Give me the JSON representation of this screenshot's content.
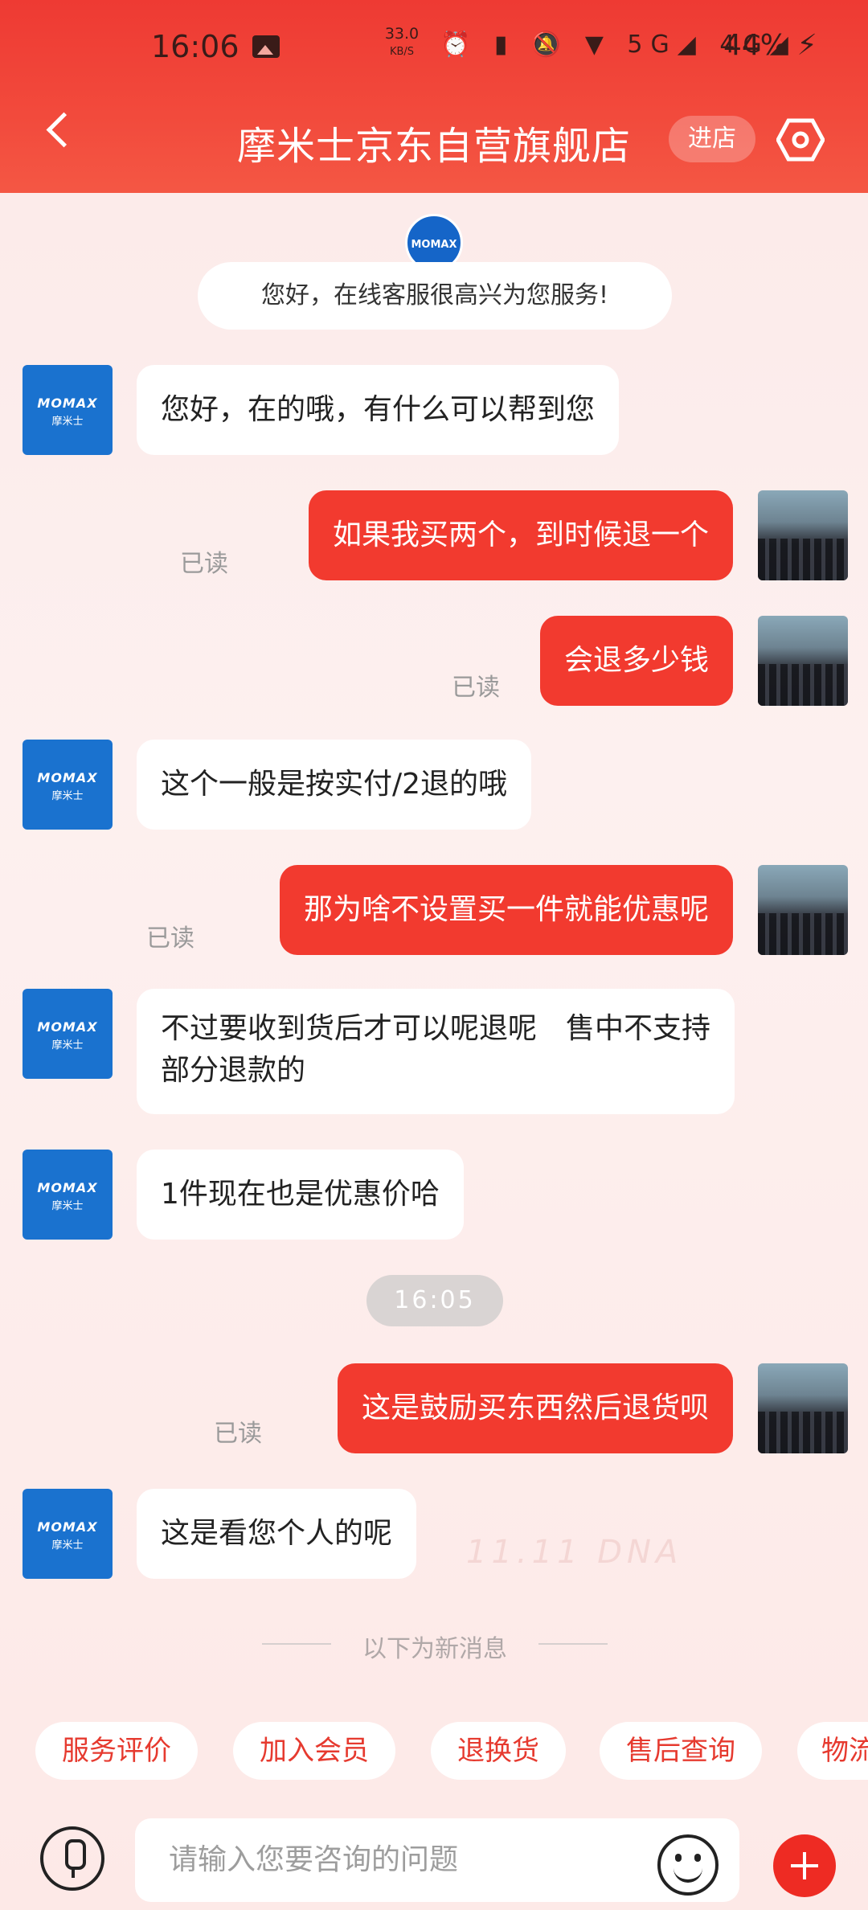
{
  "status_bar": {
    "time": "16:06",
    "net_speed": "33.0",
    "net_unit": "KB/S",
    "signal_icons": "⏰ ▮ 🔕 ▼ 5G◢ 4G◢",
    "battery": "44%"
  },
  "header": {
    "title": "摩米士京东自营旗舰店",
    "enter_label": "进店"
  },
  "welcome": {
    "logo_text": "MOMAX",
    "text": "您好，在线客服很高兴为您服务!"
  },
  "avatar_bot": {
    "brand": "MOMAX",
    "brand_cn": "摩米士"
  },
  "messages": [
    {
      "from": "agent",
      "text": "您好，在的哦，有什么可以帮到您"
    },
    {
      "from": "me",
      "text": "如果我买两个，到时候退一个",
      "status": "已读"
    },
    {
      "from": "me",
      "text": "会退多少钱",
      "status": "已读"
    },
    {
      "from": "agent",
      "text": "这个一般是按实付/2退的哦"
    },
    {
      "from": "me",
      "text": "那为啥不设置买一件就能优惠呢",
      "status": "已读"
    },
    {
      "from": "agent",
      "text": "不过要收到货后才可以呢退呢　售中不支持部分退款的"
    },
    {
      "from": "agent",
      "text": "1件现在也是优惠价哈"
    },
    {
      "from": "me",
      "text": "这是鼓励买东西然后退货呗",
      "status": "已读"
    },
    {
      "from": "agent",
      "text": "这是看您个人的呢"
    }
  ],
  "timestamp": "16:05",
  "divider_text": "以下为新消息",
  "background_mark": "11.11 DNA",
  "quick_replies": [
    "服务评价",
    "加入会员",
    "退换货",
    "售后查询",
    "物流"
  ],
  "input": {
    "placeholder": "请输入您要咨询的问题"
  },
  "colors": {
    "brand_red": "#f23a2f",
    "agent_blue": "#1a72cf"
  }
}
